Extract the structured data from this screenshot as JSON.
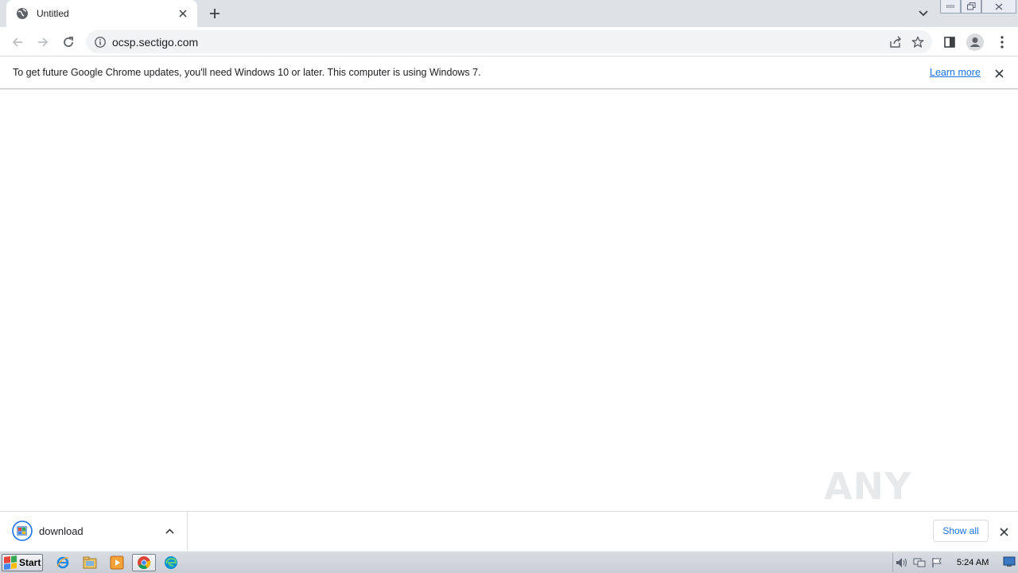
{
  "browser": {
    "tab": {
      "title": "Untitled"
    },
    "omnibox": {
      "url": "ocsp.sectigo.com"
    }
  },
  "infobar": {
    "message": "To get future Google Chrome updates, you'll need Windows 10 or later. This computer is using Windows 7.",
    "link_label": "Learn more"
  },
  "download_shelf": {
    "items": [
      {
        "name": "download"
      }
    ],
    "show_all_label": "Show all"
  },
  "watermark": {
    "text": "ANY RUN"
  },
  "taskbar": {
    "start_label": "Start",
    "pinned": [
      "internet-explorer-icon",
      "file-explorer-icon",
      "media-player-icon",
      "chrome-icon",
      "edge-icon"
    ],
    "clock": "5:24 AM"
  },
  "colors": {
    "accent": "#1a73e8",
    "tabstrip": "#dee1e6",
    "omnibox": "#f1f3f4"
  }
}
